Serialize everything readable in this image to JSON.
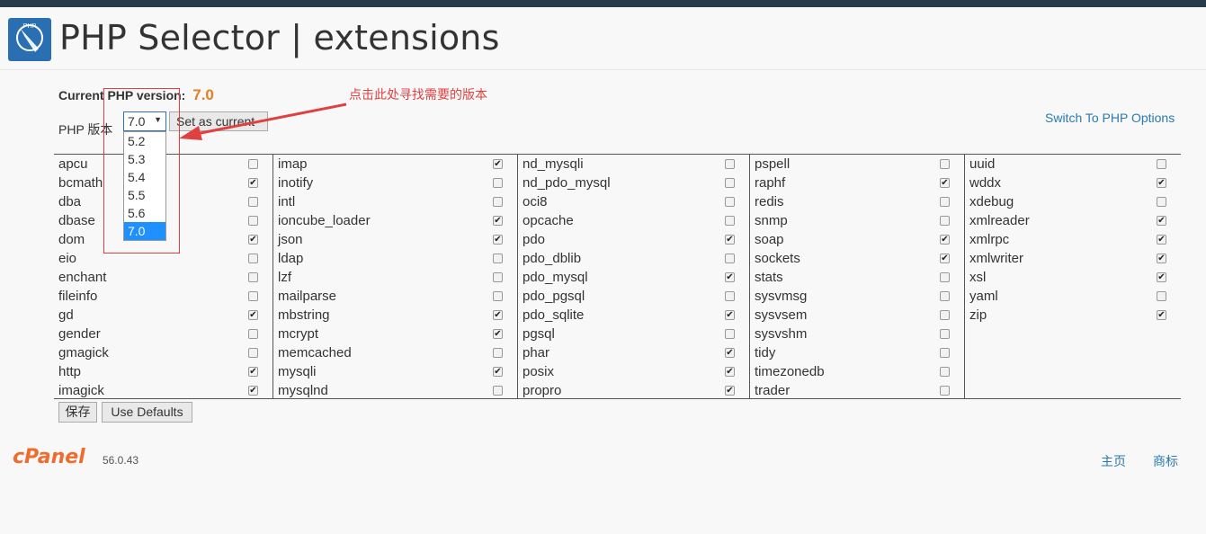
{
  "header": {
    "title": "PHP Selector | extensions",
    "logo_text": "PHP"
  },
  "current": {
    "label": "Current PHP version:",
    "value": "7.0"
  },
  "version_label": "PHP 版本",
  "version_select": {
    "selected": "7.0",
    "arrow": "▼",
    "options": [
      "5.2",
      "5.3",
      "5.4",
      "5.5",
      "5.6",
      "7.0"
    ]
  },
  "set_current_label": "Set as current",
  "annotation": {
    "text": "点击此处寻找需要的版本",
    "color": "#e04040"
  },
  "switch_link": "Switch To PHP Options",
  "extensions": [
    [
      {
        "name": "apcu",
        "checked": false
      },
      {
        "name": "bcmath",
        "checked": true
      },
      {
        "name": "dba",
        "checked": false
      },
      {
        "name": "dbase",
        "checked": false
      },
      {
        "name": "dom",
        "checked": true
      },
      {
        "name": "eio",
        "checked": false
      },
      {
        "name": "enchant",
        "checked": false
      },
      {
        "name": "fileinfo",
        "checked": false
      },
      {
        "name": "gd",
        "checked": true
      },
      {
        "name": "gender",
        "checked": false
      },
      {
        "name": "gmagick",
        "checked": false
      },
      {
        "name": "http",
        "checked": true
      },
      {
        "name": "imagick",
        "checked": true
      }
    ],
    [
      {
        "name": "imap",
        "checked": true
      },
      {
        "name": "inotify",
        "checked": false
      },
      {
        "name": "intl",
        "checked": false
      },
      {
        "name": "ioncube_loader",
        "checked": true
      },
      {
        "name": "json",
        "checked": true
      },
      {
        "name": "ldap",
        "checked": false
      },
      {
        "name": "lzf",
        "checked": false
      },
      {
        "name": "mailparse",
        "checked": false
      },
      {
        "name": "mbstring",
        "checked": true
      },
      {
        "name": "mcrypt",
        "checked": true
      },
      {
        "name": "memcached",
        "checked": false
      },
      {
        "name": "mysqli",
        "checked": true
      },
      {
        "name": "mysqlnd",
        "checked": false
      }
    ],
    [
      {
        "name": "nd_mysqli",
        "checked": false
      },
      {
        "name": "nd_pdo_mysql",
        "checked": false
      },
      {
        "name": "oci8",
        "checked": false
      },
      {
        "name": "opcache",
        "checked": false
      },
      {
        "name": "pdo",
        "checked": true
      },
      {
        "name": "pdo_dblib",
        "checked": false
      },
      {
        "name": "pdo_mysql",
        "checked": true
      },
      {
        "name": "pdo_pgsql",
        "checked": false
      },
      {
        "name": "pdo_sqlite",
        "checked": true
      },
      {
        "name": "pgsql",
        "checked": false
      },
      {
        "name": "phar",
        "checked": true
      },
      {
        "name": "posix",
        "checked": true
      },
      {
        "name": "propro",
        "checked": true
      }
    ],
    [
      {
        "name": "pspell",
        "checked": false
      },
      {
        "name": "raphf",
        "checked": true
      },
      {
        "name": "redis",
        "checked": false
      },
      {
        "name": "snmp",
        "checked": false
      },
      {
        "name": "soap",
        "checked": true
      },
      {
        "name": "sockets",
        "checked": true
      },
      {
        "name": "stats",
        "checked": false
      },
      {
        "name": "sysvmsg",
        "checked": false
      },
      {
        "name": "sysvsem",
        "checked": false
      },
      {
        "name": "sysvshm",
        "checked": false
      },
      {
        "name": "tidy",
        "checked": false
      },
      {
        "name": "timezonedb",
        "checked": false
      },
      {
        "name": "trader",
        "checked": false
      }
    ],
    [
      {
        "name": "uuid",
        "checked": false
      },
      {
        "name": "wddx",
        "checked": true
      },
      {
        "name": "xdebug",
        "checked": false
      },
      {
        "name": "xmlreader",
        "checked": true
      },
      {
        "name": "xmlrpc",
        "checked": true
      },
      {
        "name": "xmlwriter",
        "checked": true
      },
      {
        "name": "xsl",
        "checked": true
      },
      {
        "name": "yaml",
        "checked": false
      },
      {
        "name": "zip",
        "checked": true
      }
    ]
  ],
  "buttons": {
    "save": "保存",
    "defaults": "Use Defaults"
  },
  "footer": {
    "brand": "cPanel",
    "version": "56.0.43",
    "links": [
      "主页",
      "商标"
    ]
  },
  "colors": {
    "accent_orange": "#e57e25",
    "link_blue": "#2a7ab0",
    "topbar": "#293a4a",
    "selected_option": "#1e90ff"
  }
}
